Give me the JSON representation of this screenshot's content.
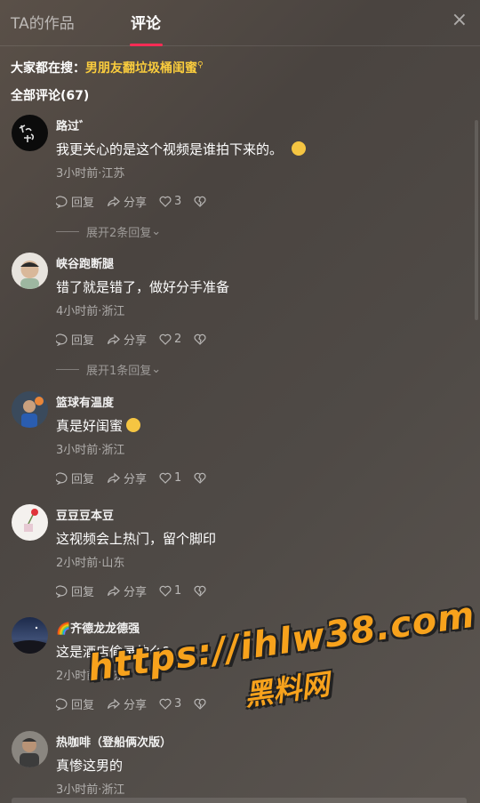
{
  "header": {
    "tab_works": "TA的作品",
    "tab_comments": "评论",
    "close_symbol": "×"
  },
  "search_hint": {
    "prefix": "大家都在搜：",
    "keyword": "男朋友翻垃圾桶闺蜜"
  },
  "comment_count_label": "全部评论(67)",
  "action_labels": {
    "reply": "回复",
    "share": "分享"
  },
  "comments": [
    {
      "user": "路过゛",
      "text": "我更关心的是这个视频是谁拍下来的。",
      "meta": "3小时前·江苏",
      "likes": "3",
      "expand": "展开2条回复"
    },
    {
      "user": "峡谷跑断腿",
      "text": "错了就是错了，做好分手准备",
      "meta": "4小时前·浙江",
      "likes": "2",
      "expand": "展开1条回复"
    },
    {
      "user": "篮球有温度",
      "text": "真是好闺蜜",
      "meta": "3小时前·浙江",
      "likes": "1"
    },
    {
      "user": "豆豆豆本豆",
      "text": "这视频会上热门，留个脚印",
      "meta": "2小时前·山东",
      "likes": "1"
    },
    {
      "user": "🌈齐德龙龙德强",
      "text": "这是酒店偷录的么?",
      "meta": "2小时前·广东",
      "likes": "3"
    },
    {
      "user": "热咖啡（登船俩次版）",
      "text": "真惨这男的",
      "meta": "3小时前·浙江"
    }
  ],
  "watermark": {
    "url": "https://ihlw38.com",
    "name": "黑料网"
  },
  "colors": {
    "accent": "#fe2c55",
    "keyword": "#facc3d",
    "watermark": "#f7a21c"
  }
}
